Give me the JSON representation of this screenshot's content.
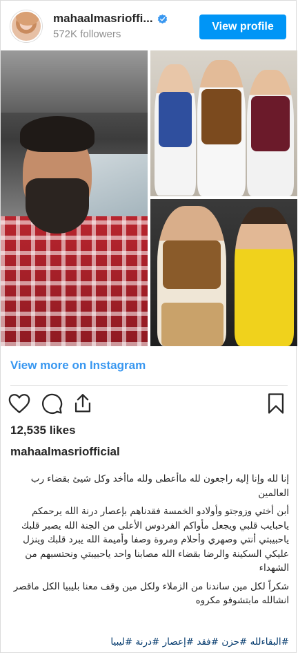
{
  "header": {
    "username": "mahaalmasrioffi...",
    "followers": "572K followers",
    "view_profile_label": "View profile"
  },
  "post": {
    "view_more_label": "View more on Instagram",
    "likes": "12,535 likes",
    "caption_username": "mahaalmasriofficial",
    "caption_paragraphs": [
      "إنا لله وإنا إليه راجعون لله ماأعطى ولله ماأخد وكل شيئ بقضاء رب العالمين",
      "أبن أختي وزوجتو وأولادو الخمسة فقدناهم بإعصار درنة الله يرحمكم ياحبايب قلبي ويجعل مأواكم الفردوس الأعلى من الجنة الله يصبر قلبك ياحبيبتي أنتي وصهري وأحلام ومروة وصفا وأميمة الله يبرد قلبك وينزل عليكي السكينة والرضا بقضاء الله مصابنا واحد ياحبيبتي ونحتسبهم من الشهداء",
      "شكراً لكل مين ساندنا من الزملاء ولكل مين وقف معنا بليبيا الكل ماقصر انشالله مابتشوفو مكروه"
    ],
    "hashtags": "#البقاءلله #حزن #فقد #إعصار #درنة #ليبيا"
  },
  "colors": {
    "accent": "#0095f6",
    "link": "#3897f0",
    "hashtag": "#00376b",
    "verified": "#3897f0"
  },
  "icons": {
    "like": "heart-icon",
    "comment": "comment-icon",
    "share": "share-icon",
    "save": "bookmark-icon",
    "verified": "verified-badge-icon"
  }
}
